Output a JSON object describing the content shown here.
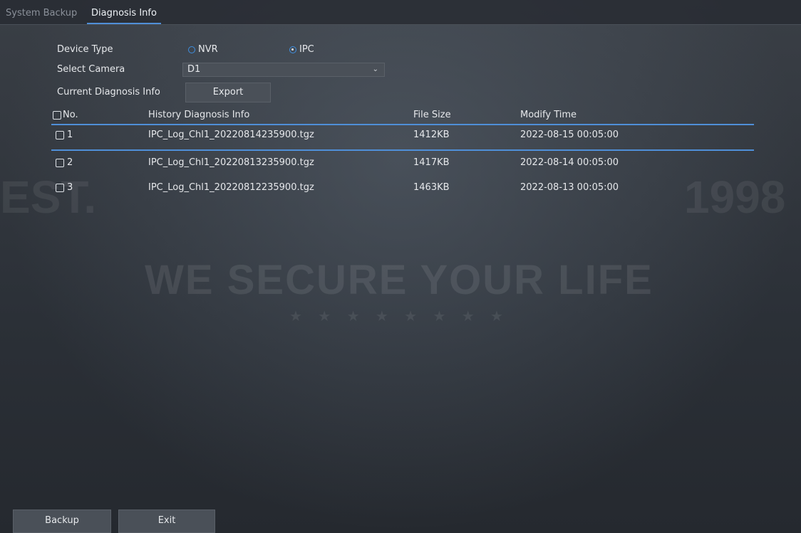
{
  "tabs": {
    "system_backup": "System Backup",
    "diagnosis_info": "Diagnosis Info"
  },
  "device_type": {
    "label": "Device Type",
    "options": [
      "NVR",
      "IPC"
    ],
    "selected": "IPC"
  },
  "select_camera": {
    "label": "Select Camera",
    "value": "D1"
  },
  "current_diagnosis": {
    "label": "Current Diagnosis Info",
    "export_label": "Export"
  },
  "table": {
    "headers": {
      "no": "No.",
      "history": "History Diagnosis Info",
      "size": "File Size",
      "time": "Modify Time"
    },
    "rows": [
      {
        "no": "1",
        "file": "IPC_Log_Chl1_20220814235900.tgz",
        "size": "1412KB",
        "time": "2022-08-15 00:05:00"
      },
      {
        "no": "2",
        "file": "IPC_Log_Chl1_20220813235900.tgz",
        "size": "1417KB",
        "time": "2022-08-14 00:05:00"
      },
      {
        "no": "3",
        "file": "IPC_Log_Chl1_20220812235900.tgz",
        "size": "1463KB",
        "time": "2022-08-13 00:05:00"
      }
    ]
  },
  "footer": {
    "backup": "Backup",
    "exit": "Exit"
  },
  "watermark": {
    "slogan": "WE SECURE YOUR LIFE",
    "est": "EST.",
    "year": "1998",
    "stars": "★ ★ ★ ★ ★ ★ ★ ★"
  },
  "colors": {
    "accent": "#4f8fd8",
    "background": "#2b3037",
    "control": "#4a5058"
  }
}
